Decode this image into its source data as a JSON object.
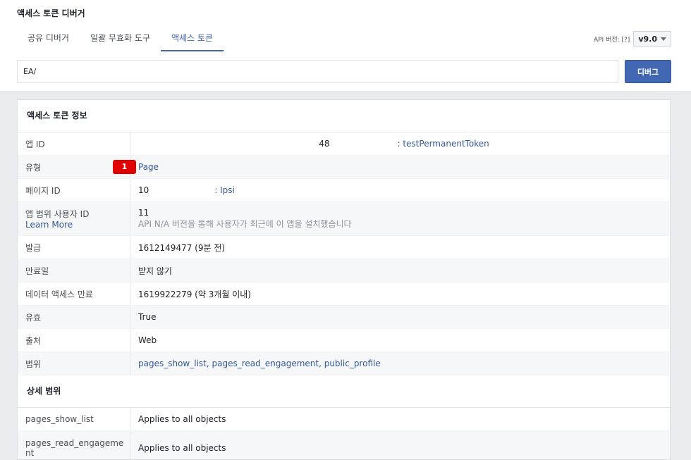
{
  "header": {
    "title": "액세스 토큰 디버거",
    "tabs": [
      {
        "label": "공유 디버거"
      },
      {
        "label": "일괄 무효화 도구"
      },
      {
        "label": "액세스 토큰"
      }
    ],
    "api_version_label": "API 버전: [?]",
    "api_version_value": "v9.0"
  },
  "token_input": {
    "value": "EA/"
  },
  "debug_button": {
    "label": "디버그"
  },
  "token_info": {
    "heading": "액세스 토큰 정보",
    "app_id": {
      "label": "앱 ID",
      "value": "48",
      "name": ": testPermanentToken"
    },
    "type": {
      "label": "유형",
      "value": "Page"
    },
    "page_id": {
      "label": "페이지 ID",
      "value": "10",
      "name": ": Ipsi"
    },
    "app_scoped_user": {
      "label": "앱 범위 사용자 ID",
      "learn_more": "Learn More",
      "value": "11",
      "note": "API N/A 버전을 통해 사용자가 최근에 이 앱을 설치했습니다"
    },
    "issued": {
      "label": "발급",
      "value": "1612149477 (9분 전)"
    },
    "expires": {
      "label": "만료일",
      "value": "받지 않기",
      "badge": "1"
    },
    "data_access_expires": {
      "label": "데이터 액세스 만료",
      "value": "1619922279 (약 3개월 이내)"
    },
    "valid": {
      "label": "유효",
      "value": "True"
    },
    "origin": {
      "label": "출처",
      "value": "Web"
    },
    "scopes": {
      "label": "범위",
      "value": "pages_show_list, pages_read_engagement, public_profile"
    }
  },
  "granular_scopes": {
    "heading": "상세 범위",
    "rows": [
      {
        "scope": "pages_show_list",
        "target": "Applies to all objects"
      },
      {
        "scope": "pages_read_engageme nt",
        "target": "Applies to all objects"
      }
    ]
  },
  "colors": {
    "accent": "#4267b2",
    "badge": "#e00000",
    "background": "#e9ebee"
  }
}
